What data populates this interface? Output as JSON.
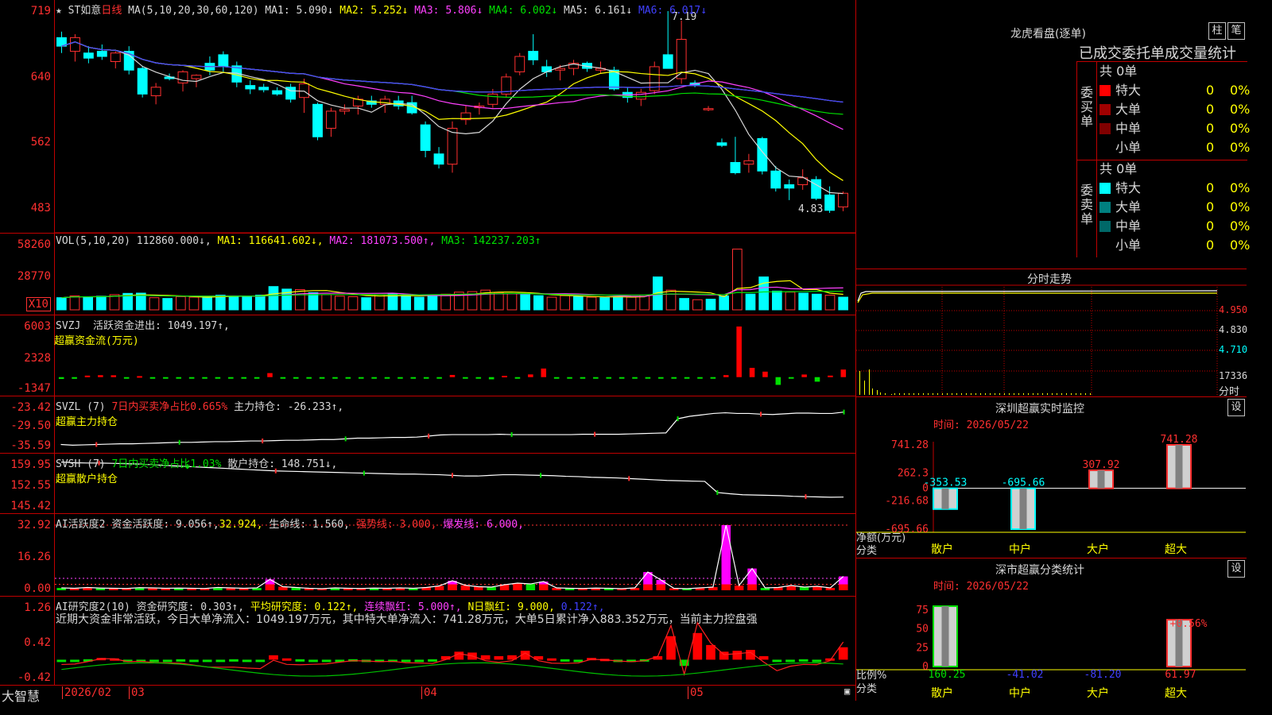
{
  "main": {
    "title_prefix": "★",
    "stock_name": "ST如意",
    "period": "日线",
    "ma_params": "MA(5,10,20,30,60,120)",
    "ma": [
      {
        "label": "MA1: 5.090↓",
        "color": "#d8d8d8"
      },
      {
        "label": "MA2: 5.252↓",
        "color": "#ffff00"
      },
      {
        "label": "MA3: 5.806↓",
        "color": "#ff40ff"
      },
      {
        "label": "MA4: 6.002↓",
        "color": "#00e000"
      },
      {
        "label": "MA5: 6.161↓",
        "color": "#d8d8d8"
      },
      {
        "label": "MA6: 6.017↓",
        "color": "#4040ff"
      }
    ],
    "y_labels": [
      "719",
      "640",
      "562",
      "483"
    ],
    "y_range": [
      4.83,
      7.19
    ],
    "high_marker": "7.19",
    "low_marker": "4.83",
    "candles": [
      {
        "o": 6.88,
        "h": 6.95,
        "l": 6.7,
        "c": 6.78
      },
      {
        "o": 6.72,
        "h": 6.92,
        "l": 6.6,
        "c": 6.88
      },
      {
        "o": 6.7,
        "h": 6.78,
        "l": 6.58,
        "c": 6.64
      },
      {
        "o": 6.72,
        "h": 6.8,
        "l": 6.62,
        "c": 6.66
      },
      {
        "o": 6.6,
        "h": 6.72,
        "l": 6.52,
        "c": 6.7
      },
      {
        "o": 6.72,
        "h": 6.78,
        "l": 6.45,
        "c": 6.5
      },
      {
        "o": 6.52,
        "h": 6.55,
        "l": 6.18,
        "c": 6.22
      },
      {
        "o": 6.2,
        "h": 6.35,
        "l": 6.1,
        "c": 6.3
      },
      {
        "o": 6.42,
        "h": 6.46,
        "l": 6.38,
        "c": 6.4
      },
      {
        "o": 6.35,
        "h": 6.5,
        "l": 6.25,
        "c": 6.48
      },
      {
        "o": 6.4,
        "h": 6.45,
        "l": 6.3,
        "c": 6.44
      },
      {
        "o": 6.58,
        "h": 6.66,
        "l": 6.44,
        "c": 6.5
      },
      {
        "o": 6.68,
        "h": 6.72,
        "l": 6.48,
        "c": 6.54
      },
      {
        "o": 6.55,
        "h": 6.6,
        "l": 6.3,
        "c": 6.36
      },
      {
        "o": 6.32,
        "h": 6.38,
        "l": 6.22,
        "c": 6.28
      },
      {
        "o": 6.3,
        "h": 6.34,
        "l": 6.24,
        "c": 6.27
      },
      {
        "o": 6.26,
        "h": 6.3,
        "l": 6.2,
        "c": 6.22
      },
      {
        "o": 6.3,
        "h": 6.34,
        "l": 6.12,
        "c": 6.16
      },
      {
        "o": 6.18,
        "h": 6.4,
        "l": 6.0,
        "c": 6.34
      },
      {
        "o": 6.1,
        "h": 6.12,
        "l": 5.68,
        "c": 5.72
      },
      {
        "o": 5.82,
        "h": 6.06,
        "l": 5.72,
        "c": 6.02
      },
      {
        "o": 6.02,
        "h": 6.1,
        "l": 5.98,
        "c": 6.04
      },
      {
        "o": 6.08,
        "h": 6.2,
        "l": 5.98,
        "c": 6.16
      },
      {
        "o": 6.14,
        "h": 6.2,
        "l": 6.06,
        "c": 6.1
      },
      {
        "o": 6.1,
        "h": 6.2,
        "l": 6.0,
        "c": 6.16
      },
      {
        "o": 6.14,
        "h": 6.2,
        "l": 6.04,
        "c": 6.08
      },
      {
        "o": 6.12,
        "h": 6.2,
        "l": 5.98,
        "c": 6.0
      },
      {
        "o": 5.86,
        "h": 5.9,
        "l": 5.48,
        "c": 5.56
      },
      {
        "o": 5.52,
        "h": 5.6,
        "l": 5.35,
        "c": 5.4
      },
      {
        "o": 5.4,
        "h": 5.9,
        "l": 5.3,
        "c": 5.82
      },
      {
        "o": 5.92,
        "h": 6.08,
        "l": 5.86,
        "c": 6.0
      },
      {
        "o": 6.06,
        "h": 6.12,
        "l": 5.98,
        "c": 6.08
      },
      {
        "o": 6.1,
        "h": 6.28,
        "l": 6.06,
        "c": 6.22
      },
      {
        "o": 6.22,
        "h": 6.46,
        "l": 6.18,
        "c": 6.42
      },
      {
        "o": 6.48,
        "h": 6.7,
        "l": 6.44,
        "c": 6.66
      },
      {
        "o": 6.72,
        "h": 6.92,
        "l": 6.56,
        "c": 6.62
      },
      {
        "o": 6.54,
        "h": 6.62,
        "l": 6.42,
        "c": 6.48
      },
      {
        "o": 6.5,
        "h": 6.56,
        "l": 6.38,
        "c": 6.52
      },
      {
        "o": 6.52,
        "h": 6.62,
        "l": 6.44,
        "c": 6.58
      },
      {
        "o": 6.58,
        "h": 6.6,
        "l": 6.48,
        "c": 6.52
      },
      {
        "o": 6.5,
        "h": 6.6,
        "l": 6.46,
        "c": 6.52
      },
      {
        "o": 6.5,
        "h": 6.54,
        "l": 6.26,
        "c": 6.28
      },
      {
        "o": 6.24,
        "h": 6.3,
        "l": 6.12,
        "c": 6.18
      },
      {
        "o": 6.16,
        "h": 6.28,
        "l": 6.08,
        "c": 6.24
      },
      {
        "o": 6.26,
        "h": 6.6,
        "l": 6.22,
        "c": 6.54
      },
      {
        "o": 6.68,
        "h": 7.19,
        "l": 6.58,
        "c": 6.52
      },
      {
        "o": 6.4,
        "h": 7.08,
        "l": 6.34,
        "c": 6.86
      },
      {
        "o": 6.35,
        "h": 6.38,
        "l": 6.3,
        "c": 6.33
      },
      {
        "o": 6.05,
        "h": 6.08,
        "l": 6.02,
        "c": 6.05
      },
      {
        "o": 5.65,
        "h": 5.7,
        "l": 5.6,
        "c": 5.62
      },
      {
        "o": 5.42,
        "h": 5.72,
        "l": 5.28,
        "c": 5.3
      },
      {
        "o": 5.4,
        "h": 5.52,
        "l": 5.3,
        "c": 5.44
      },
      {
        "o": 5.7,
        "h": 5.72,
        "l": 5.28,
        "c": 5.32
      },
      {
        "o": 5.32,
        "h": 5.38,
        "l": 5.08,
        "c": 5.12
      },
      {
        "o": 5.16,
        "h": 5.22,
        "l": 4.98,
        "c": 5.12
      },
      {
        "o": 5.16,
        "h": 5.34,
        "l": 5.1,
        "c": 5.24
      },
      {
        "o": 5.22,
        "h": 5.26,
        "l": 4.98,
        "c": 5.0
      },
      {
        "o": 5.04,
        "h": 5.14,
        "l": 4.83,
        "c": 4.86
      },
      {
        "o": 4.9,
        "h": 5.08,
        "l": 4.85,
        "c": 5.06
      }
    ]
  },
  "vol": {
    "title": "VOL(5,10,20)",
    "value": "112860.000↓,",
    "ma": [
      {
        "label": "MA1: 116641.602↓,",
        "color": "#ffff00"
      },
      {
        "label": "MA2: 181073.500↑,",
        "color": "#ff40ff"
      },
      {
        "label": "MA3: 142237.203↑",
        "color": "#00e000"
      }
    ],
    "y_labels": [
      "58260",
      "28770"
    ],
    "unit": "X10",
    "values": [
      48,
      55,
      52,
      54,
      60,
      65,
      66,
      48,
      45,
      52,
      50,
      54,
      58,
      52,
      55,
      58,
      92,
      82,
      80,
      68,
      60,
      54,
      52,
      48,
      60,
      64,
      56,
      50,
      54,
      62,
      70,
      72,
      78,
      68,
      64,
      60,
      56,
      50,
      56,
      52,
      50,
      48,
      52,
      50,
      58,
      130,
      78,
      45,
      40,
      42,
      55,
      240,
      62,
      130,
      74,
      70,
      66,
      62,
      58,
      50
    ],
    "max": 270
  },
  "svzj": {
    "title": "SVZJ",
    "main_label": "活跃资金进出: 1049.197↑,",
    "sub_label": "超赢资金流(万元)",
    "y_labels": [
      "6003",
      "2328",
      "-1347"
    ],
    "range": [
      -1347,
      6003
    ],
    "values": [
      -220,
      -200,
      180,
      230,
      220,
      -140,
      120,
      -160,
      -150,
      -140,
      -160,
      -130,
      -140,
      -160,
      -150,
      -120,
      480,
      -140,
      -150,
      -170,
      -130,
      -160,
      -150,
      -140,
      -150,
      -160,
      -150,
      -130,
      -150,
      -140,
      260,
      -160,
      -150,
      -260,
      160,
      -120,
      320,
      1020,
      -160,
      -150,
      -140,
      -180,
      -150,
      -160,
      -140,
      -180,
      -170,
      -150,
      -160,
      -120,
      -140,
      240,
      6003,
      1100,
      650,
      -920,
      -180,
      310,
      -540,
      180,
      900
    ]
  },
  "svzl": {
    "title": "SVZL (7)",
    "ratio_label": "7日内买卖净占比0.665%",
    "hold_label": "主力持仓: -26.233↑,",
    "sub_label": "超赢主力持仓",
    "y_labels": [
      "-23.42",
      "-29.50",
      "-35.59"
    ],
    "range": [
      -35.59,
      -23.42
    ],
    "values": [
      -34.8,
      -35.0,
      -34.9,
      -34.8,
      -34.7,
      -34.6,
      -34.6,
      -34.5,
      -34.4,
      -34.3,
      -34.2,
      -34.2,
      -34.1,
      -34.0,
      -34.0,
      -33.9,
      -33.8,
      -33.8,
      -33.7,
      -33.6,
      -33.6,
      -33.5,
      -33.4,
      -33.4,
      -33.2,
      -33.0,
      -33.0,
      -32.9,
      -32.8,
      -32.8,
      -32.7,
      -32.4,
      -32.1,
      -32.0,
      -32.0,
      -32.0,
      -32.0,
      -31.9,
      -32.0,
      -32.0,
      -32.0,
      -32.0,
      -32.0,
      -32.0,
      -31.9,
      -31.9,
      -31.9,
      -31.9,
      -31.8,
      -31.7,
      -31.6,
      -31.5,
      -27.5,
      -26.8,
      -26.4,
      -26.0,
      -25.8,
      -26.0,
      -26.0,
      -26.2,
      -26.3,
      -26.1,
      -25.9,
      -25.9,
      -26.0,
      -26.0,
      -25.6
    ]
  },
  "svsh": {
    "title": "SVSH (7)",
    "ratio_label": "7日内买卖净占比1.03%",
    "hold_label": "散户持仓: 148.751↓,",
    "sub_label": "超赢散户持仓",
    "y_labels": [
      "159.95",
      "152.55",
      "145.42"
    ],
    "range": [
      145.42,
      159.95
    ],
    "values": [
      159.8,
      159.6,
      159.5,
      159.5,
      159.4,
      159.3,
      159.2,
      159.0,
      158.8,
      158.6,
      158.4,
      158.2,
      158.0,
      157.8,
      157.6,
      157.4,
      157.2,
      157.0,
      156.9,
      156.8,
      156.7,
      156.6,
      156.5,
      156.4,
      156.3,
      156.2,
      156.1,
      156.0,
      156.0,
      155.9,
      155.8,
      155.6,
      155.4,
      155.4,
      155.6,
      155.8,
      155.8,
      155.7,
      155.6,
      155.5,
      155.3,
      155.2,
      155.0,
      154.9,
      154.8,
      154.6,
      154.4,
      154.2,
      154.0,
      153.9,
      153.8,
      153.7,
      150.2,
      149.8,
      149.5,
      149.4,
      149.3,
      149.2,
      149.0,
      148.9,
      148.8,
      148.7,
      148.75
    ]
  },
  "ai": {
    "title": "AI活跃度2",
    "activity_label": "资金活跃度: 9.056↑,",
    "activity_value": "32.924,",
    "life_label": "生命线: 1.560,",
    "strong_label": "强势线: 3.000,",
    "burst_label": "爆发线: 6.000,",
    "y_labels": [
      "32.92",
      "16.26",
      "0.00"
    ],
    "range": [
      0,
      32.92
    ],
    "values": [
      1.2,
      1.0,
      1.4,
      1.1,
      1.0,
      0.9,
      1.3,
      1.2,
      1.0,
      1.1,
      1.0,
      0.9,
      1.4,
      1.2,
      1.0,
      1.2,
      5.5,
      1.8,
      1.4,
      1.0,
      0.8,
      1.2,
      1.0,
      0.9,
      1.1,
      1.0,
      1.2,
      1.0,
      1.4,
      2.2,
      4.8,
      2.5,
      1.8,
      1.6,
      2.8,
      3.6,
      3.2,
      4.4,
      1.2,
      1.0,
      0.9,
      1.1,
      1.0,
      0.8,
      1.2,
      9.2,
      5.2,
      1.0,
      0.8,
      1.2,
      1.6,
      32.92,
      2.4,
      11.0,
      1.2,
      1.4,
      2.4,
      1.6,
      2.0,
      1.2,
      7.0
    ]
  },
  "research": {
    "title": "AI研究度2(10)",
    "research_label": "资金研究度: 0.303↑,",
    "avg_label": "平均研究度: 0.122↑,",
    "streak_label": "连续飘红: 5.000↑,",
    "nday_label": "N日飘红: 9.000,",
    "nday_value": "0.122↑,",
    "summary": "近期大资金非常活跃，今日大单净流入：1049.197万元，其中特大单净流入：741.28万元，大单5日累计净入883.352万元，当前主力控盘强",
    "y_labels": [
      "1.26",
      "0.42",
      "-0.42"
    ],
    "range": [
      -0.42,
      1.26
    ],
    "values": [
      0.02,
      0.01,
      0.03,
      0.06,
      0.05,
      0.01,
      0.02,
      0.01,
      0.02,
      0.03,
      0.02,
      0.01,
      0.02,
      0.03,
      0.02,
      0.01,
      0.12,
      0.05,
      0.03,
      0.02,
      0.01,
      0.02,
      0.03,
      0.02,
      0.01,
      0.02,
      0.01,
      0.02,
      0.03,
      0.1,
      0.2,
      0.18,
      0.12,
      0.1,
      0.12,
      0.22,
      0.1,
      0.05,
      0.03,
      0.02,
      0.06,
      0.04,
      0.02,
      0.01,
      0.03,
      0.1,
      0.55,
      -0.12,
      0.62,
      0.35,
      0.2,
      0.22,
      0.24,
      0.1,
      -0.03,
      0.02,
      0.03,
      0.01,
      0.05,
      0.3
    ]
  },
  "xaxis": {
    "labels": [
      "2026/02",
      "03",
      "04",
      "05"
    ]
  },
  "brand": "大智慧",
  "lhb": {
    "title": "龙虎看盘(逐单)",
    "btn_column": "柱",
    "btn_pen": "笔",
    "header": "已成交委托单成交量统计",
    "buy_side": "委买单",
    "sell_side": "委卖单",
    "buy_total": "共 0单",
    "sell_total": "共 0单",
    "buy_rows": [
      {
        "label": "特大",
        "value": "0",
        "pct": "0%",
        "color": "#ff0000"
      },
      {
        "label": "大单",
        "value": "0",
        "pct": "0%",
        "color": "#a00000"
      },
      {
        "label": "中单",
        "value": "0",
        "pct": "0%",
        "color": "#800000"
      },
      {
        "label": "小单",
        "value": "0",
        "pct": "0%",
        "color": ""
      }
    ],
    "sell_rows": [
      {
        "label": "特大",
        "value": "0",
        "pct": "0%",
        "color": "#00ffff"
      },
      {
        "label": "大单",
        "value": "0",
        "pct": "0%",
        "color": "#008080"
      },
      {
        "label": "中单",
        "value": "0",
        "pct": "0%",
        "color": "#006868"
      },
      {
        "label": "小单",
        "value": "0",
        "pct": "0%",
        "color": ""
      }
    ]
  },
  "intraday": {
    "title": "分时走势",
    "labels": [
      "4.950",
      "4.830",
      "4.710",
      "17336",
      "分时"
    ]
  },
  "sz_monitor": {
    "title": "深圳超赢实时监控",
    "setting": "设",
    "time_label": "时间: 2026/05/22",
    "y_labels": [
      "741.28",
      "262.3",
      "0",
      "-216.68",
      "-695.66"
    ],
    "axis_label": "净额(万元)",
    "cat_label": "分类",
    "chart_data": {
      "type": "bar",
      "categories": [
        "散户",
        "中户",
        "大户",
        "超大"
      ],
      "values": [
        -353.53,
        -695.66,
        307.92,
        741.28
      ],
      "ylim": [
        -695.66,
        741.28
      ]
    },
    "value_labels": [
      "-353.53",
      "-695.66",
      "307.92",
      "741.28"
    ]
  },
  "sz_class": {
    "title": "深市超赢分类统计",
    "setting": "设",
    "time_label": "时间: 2026/05/22",
    "y_labels": [
      "75",
      "50",
      "25",
      "0"
    ],
    "axis_label": "比例%",
    "cat_label": "分类",
    "pct_label": "+0.56%",
    "chart_data": {
      "type": "bar",
      "categories": [
        "散户",
        "中户",
        "大户",
        "超大"
      ],
      "values": [
        160.25,
        -41.02,
        -81.2,
        61.97
      ],
      "ylim": [
        0,
        75
      ]
    },
    "value_labels": [
      "160.25",
      "-41.02",
      "-81.20",
      "61.97"
    ]
  }
}
